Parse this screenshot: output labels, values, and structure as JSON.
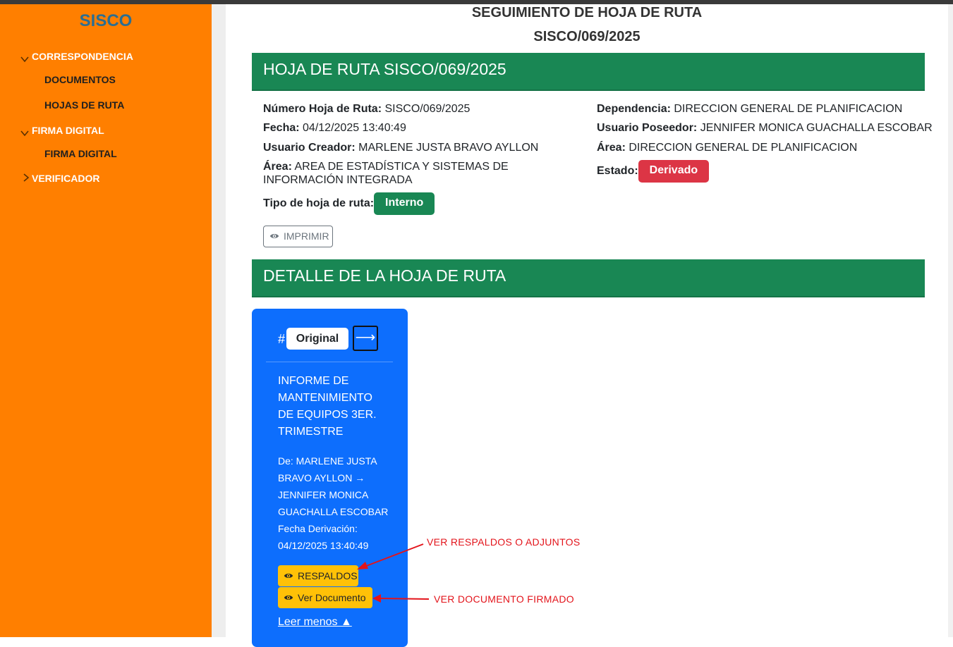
{
  "sidebar": {
    "brand": "SISCO",
    "items": [
      {
        "label": "CORRESPONDENCIA"
      },
      {
        "label": "DOCUMENTOS"
      },
      {
        "label": "HOJAS DE RUTA"
      },
      {
        "label": "FIRMA DIGITAL"
      },
      {
        "label": "FIRMA DIGITAL"
      },
      {
        "label": "VERIFICADOR"
      }
    ]
  },
  "page": {
    "title_line1": "SEGUIMIENTO DE HOJA DE RUTA",
    "title_line2": "SISCO/069/2025"
  },
  "header": {
    "title": "HOJA DE RUTA SISCO/069/2025"
  },
  "details": {
    "numero": {
      "label": "Número Hoja de Ruta:",
      "value": "SISCO/069/2025"
    },
    "fecha": {
      "label": "Fecha:",
      "value": "04/12/2025 13:40:49"
    },
    "creador": {
      "label": "Usuario Creador:",
      "value": "MARLENE JUSTA BRAVO AYLLON"
    },
    "area_creador": {
      "label": "Área:",
      "value": "AREA DE ESTADÍSTICA Y SISTEMAS DE INFORMACIÓN INTEGRADA"
    },
    "tipo": {
      "label": "Tipo de hoja de ruta:",
      "value": "Interno"
    },
    "dependencia": {
      "label": "Dependencia:",
      "value": "DIRECCION GENERAL DE PLANIFICACION"
    },
    "poseedor": {
      "label": "Usuario Poseedor:",
      "value": "JENNIFER MONICA GUACHALLA ESCOBAR"
    },
    "area_poseedor": {
      "label": "Área:",
      "value": "DIRECCION GENERAL DE PLANIFICACION"
    },
    "estado": {
      "label": "Estado:",
      "value": "Derivado"
    }
  },
  "print_button": "IMPRIMIR",
  "detail_header": "DETALLE DE LA HOJA DE RUTA",
  "card": {
    "hash": "#",
    "original_label": "Original",
    "arrow_label": "⟶",
    "title": "INFORME DE MANTENIMIENTO DE EQUIPOS 3ER. TRIMESTRE",
    "from_to": "De: MARLENE JUSTA BRAVO AYLLON → JENNIFER MONICA GUACHALLA ESCOBAR",
    "fecha_label": "Fecha Derivación:",
    "fecha_value": "04/12/2025 13:40:49",
    "respaldos_label": "RESPALDOS",
    "ver_documento_label": "Ver Documento",
    "leer_menos": "Leer menos ▲"
  },
  "annotations": {
    "respaldos": "VER RESPALDOS O ADJUNTOS",
    "documento": "VER DOCUMENTO FIRMADO"
  },
  "colors": {
    "sidebar": "#ff7f00",
    "brand": "#2c6e91",
    "header_green": "#198754",
    "badge_red": "#dc3545",
    "card_blue": "#0d6efd",
    "button_yellow": "#ffc107",
    "annotation_red": "#e3141b"
  },
  "icons": {
    "expand": "chevron-down-icon",
    "collapse": "chevron-right-icon",
    "view": "eye-icon"
  }
}
